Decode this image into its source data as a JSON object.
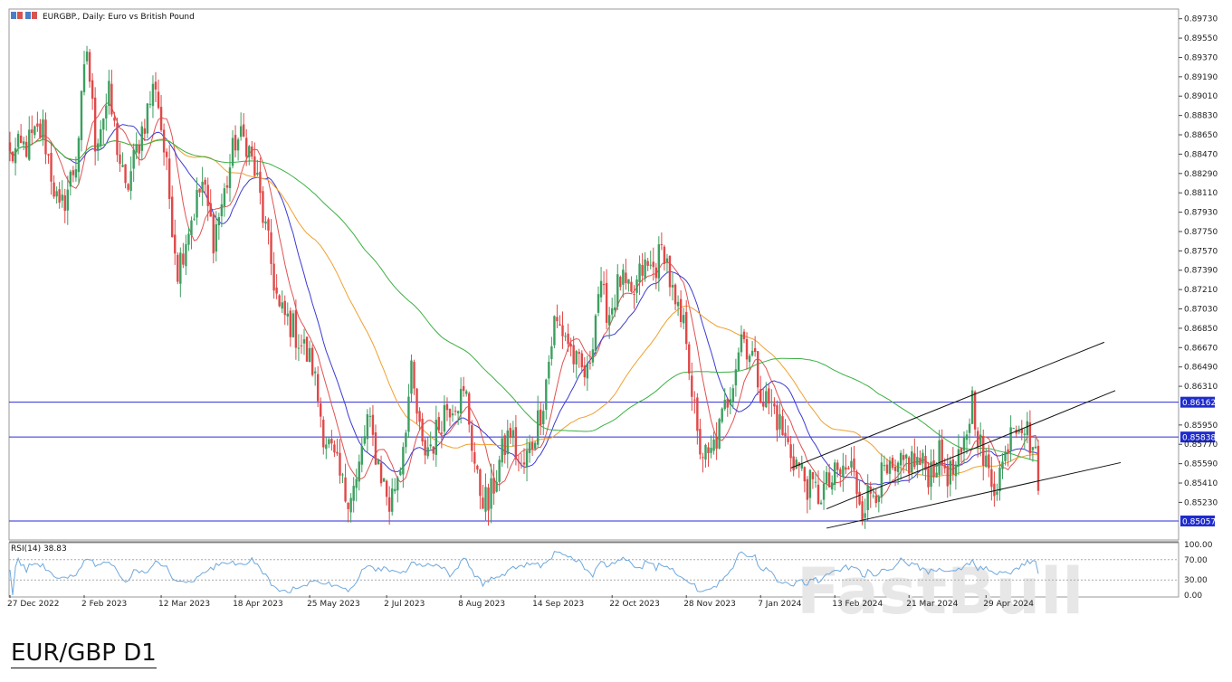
{
  "header": {
    "title": "EURGBP., Daily:  Euro vs British Pound"
  },
  "caption": "EUR/GBP D1",
  "watermark": "FastBull",
  "chart_data": [
    {
      "type": "candlestick",
      "symbol": "EURGBP.",
      "timeframe": "Daily",
      "title": "EURGBP., Daily:  Euro vs British Pound",
      "ylim": [
        0.8488,
        0.8982
      ],
      "y_ticks": [
        "0.89730",
        "0.89550",
        "0.89370",
        "0.89190",
        "0.89010",
        "0.88830",
        "0.88650",
        "0.88470",
        "0.88290",
        "0.88110",
        "0.87930",
        "0.87750",
        "0.87570",
        "0.87390",
        "0.87210",
        "0.87030",
        "0.86850",
        "0.86670",
        "0.86490",
        "0.86310",
        "0.85950",
        "0.85770",
        "0.85590",
        "0.85410",
        "0.85230"
      ],
      "y_tick_values": [
        0.8973,
        0.8955,
        0.8937,
        0.8919,
        0.8901,
        0.8883,
        0.8865,
        0.8847,
        0.8829,
        0.8811,
        0.8793,
        0.8775,
        0.8757,
        0.8739,
        0.8721,
        0.8703,
        0.8685,
        0.8667,
        0.8649,
        0.8631,
        0.8595,
        0.8577,
        0.8559,
        0.8541,
        0.8523
      ],
      "x_ticks": [
        "27 Dec 2022",
        "2 Feb 2023",
        "12 Mar 2023",
        "18 Apr 2023",
        "25 May 2023",
        "2 Jul 2023",
        "8 Aug 2023",
        "14 Sep 2023",
        "22 Oct 2023",
        "28 Nov 2023",
        "7 Jan 2024",
        "13 Feb 2024",
        "21 Mar 2024",
        "29 Apr 2024"
      ],
      "x_tick_bars": [
        0,
        27,
        55,
        82,
        109,
        137,
        164,
        191,
        219,
        246,
        273,
        300,
        327,
        355
      ],
      "horizontal_levels": [
        {
          "label": "0.86162",
          "value": 0.86162
        },
        {
          "label": "0.85838",
          "value": 0.85838
        },
        {
          "label": "0.85057",
          "value": 0.85057
        }
      ],
      "channel_lines": [
        {
          "from": [
            284,
            0.8555
          ],
          "to": [
            398,
            0.8672
          ]
        },
        {
          "from": [
            297,
            0.8517
          ],
          "to": [
            402,
            0.8627
          ]
        },
        {
          "from": [
            297,
            0.8499
          ],
          "to": [
            404,
            0.856
          ]
        }
      ],
      "price_path": [
        [
          0,
          0.8845
        ],
        [
          6,
          0.8855
        ],
        [
          12,
          0.887
        ],
        [
          18,
          0.879
        ],
        [
          24,
          0.884
        ],
        [
          28,
          0.8945
        ],
        [
          31,
          0.886
        ],
        [
          36,
          0.89
        ],
        [
          42,
          0.881
        ],
        [
          48,
          0.887
        ],
        [
          53,
          0.8915
        ],
        [
          57,
          0.883
        ],
        [
          61,
          0.874
        ],
        [
          65,
          0.878
        ],
        [
          70,
          0.882
        ],
        [
          74,
          0.877
        ],
        [
          78,
          0.881
        ],
        [
          82,
          0.886
        ],
        [
          86,
          0.886
        ],
        [
          90,
          0.882
        ],
        [
          94,
          0.876
        ],
        [
          98,
          0.87
        ],
        [
          102,
          0.869
        ],
        [
          106,
          0.867
        ],
        [
          110,
          0.865
        ],
        [
          114,
          0.859
        ],
        [
          118,
          0.856
        ],
        [
          122,
          0.853
        ],
        [
          126,
          0.854
        ],
        [
          130,
          0.86
        ],
        [
          134,
          0.856
        ],
        [
          138,
          0.852
        ],
        [
          142,
          0.856
        ],
        [
          146,
          0.864
        ],
        [
          150,
          0.857
        ],
        [
          154,
          0.858
        ],
        [
          158,
          0.861
        ],
        [
          162,
          0.862
        ],
        [
          166,
          0.862
        ],
        [
          170,
          0.854
        ],
        [
          174,
          0.852
        ],
        [
          178,
          0.856
        ],
        [
          182,
          0.859
        ],
        [
          186,
          0.855
        ],
        [
          190,
          0.858
        ],
        [
          194,
          0.862
        ],
        [
          198,
          0.869
        ],
        [
          202,
          0.868
        ],
        [
          206,
          0.865
        ],
        [
          210,
          0.864
        ],
        [
          214,
          0.872
        ],
        [
          218,
          0.87
        ],
        [
          222,
          0.873
        ],
        [
          226,
          0.871
        ],
        [
          230,
          0.874
        ],
        [
          234,
          0.874
        ],
        [
          238,
          0.876
        ],
        [
          242,
          0.87
        ],
        [
          246,
          0.868
        ],
        [
          250,
          0.858
        ],
        [
          254,
          0.856
        ],
        [
          258,
          0.859
        ],
        [
          262,
          0.863
        ],
        [
          266,
          0.868
        ],
        [
          270,
          0.866
        ],
        [
          274,
          0.862
        ],
        [
          278,
          0.861
        ],
        [
          282,
          0.858
        ],
        [
          286,
          0.856
        ],
        [
          290,
          0.854
        ],
        [
          294,
          0.853
        ],
        [
          298,
          0.854
        ],
        [
          302,
          0.855
        ],
        [
          306,
          0.8555
        ],
        [
          310,
          0.852
        ],
        [
          314,
          0.8535
        ],
        [
          318,
          0.8548
        ],
        [
          322,
          0.8545
        ],
        [
          326,
          0.8562
        ],
        [
          330,
          0.856
        ],
        [
          334,
          0.8552
        ],
        [
          338,
          0.8565
        ],
        [
          342,
          0.8548
        ],
        [
          346,
          0.856
        ],
        [
          350,
          0.862
        ],
        [
          354,
          0.856
        ],
        [
          358,
          0.854
        ],
        [
          362,
          0.8565
        ],
        [
          364,
          0.86
        ],
        [
          368,
          0.86
        ],
        [
          372,
          0.8575
        ],
        [
          374,
          0.8548
        ]
      ],
      "moving_averages": [
        {
          "color": "#e05252"
        },
        {
          "color": "#3b3bd1"
        },
        {
          "color": "#f0a030"
        },
        {
          "color": "#3cb043"
        }
      ],
      "colors": {
        "bull": "#3c9f60",
        "bear": "#e04848",
        "level": "#2b2bd6",
        "channel": "#111111"
      }
    },
    {
      "type": "line",
      "name": "RSI(14)",
      "label": "RSI(14) 38.83",
      "ylim": [
        0,
        100
      ],
      "y_ticks": [
        "100.00",
        "70.00",
        "30.00",
        "0.00"
      ],
      "y_tick_values": [
        100,
        70,
        30,
        0
      ],
      "color": "#6fa8dc"
    }
  ]
}
